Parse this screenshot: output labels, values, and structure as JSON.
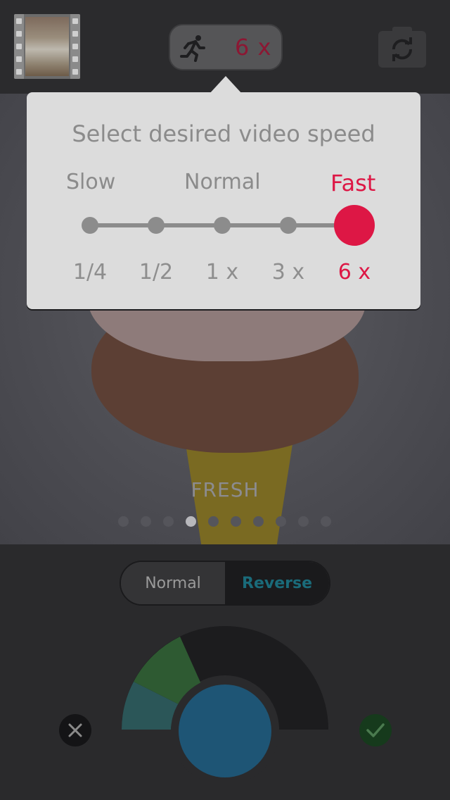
{
  "top_bar": {
    "speed_value": "6 x"
  },
  "speed_popup": {
    "title": "Select desired video speed",
    "groups": {
      "slow": "Slow",
      "normal": "Normal",
      "fast": "Fast"
    },
    "options": [
      "1/4",
      "1/2",
      "1 x",
      "3 x",
      "6 x"
    ],
    "selected_index": 4,
    "accent_color": "#dd1745"
  },
  "preview": {
    "filter_label": "FRESH",
    "page_count": 10,
    "active_page": 4
  },
  "direction": {
    "normal_label": "Normal",
    "reverse_label": "Reverse",
    "selected": "Reverse",
    "accent_color": "#1a6b7a"
  },
  "icons": {
    "runner": "runner-icon",
    "camera_switch": "camera-switch-icon",
    "cancel": "close-icon",
    "confirm": "checkmark-icon"
  }
}
